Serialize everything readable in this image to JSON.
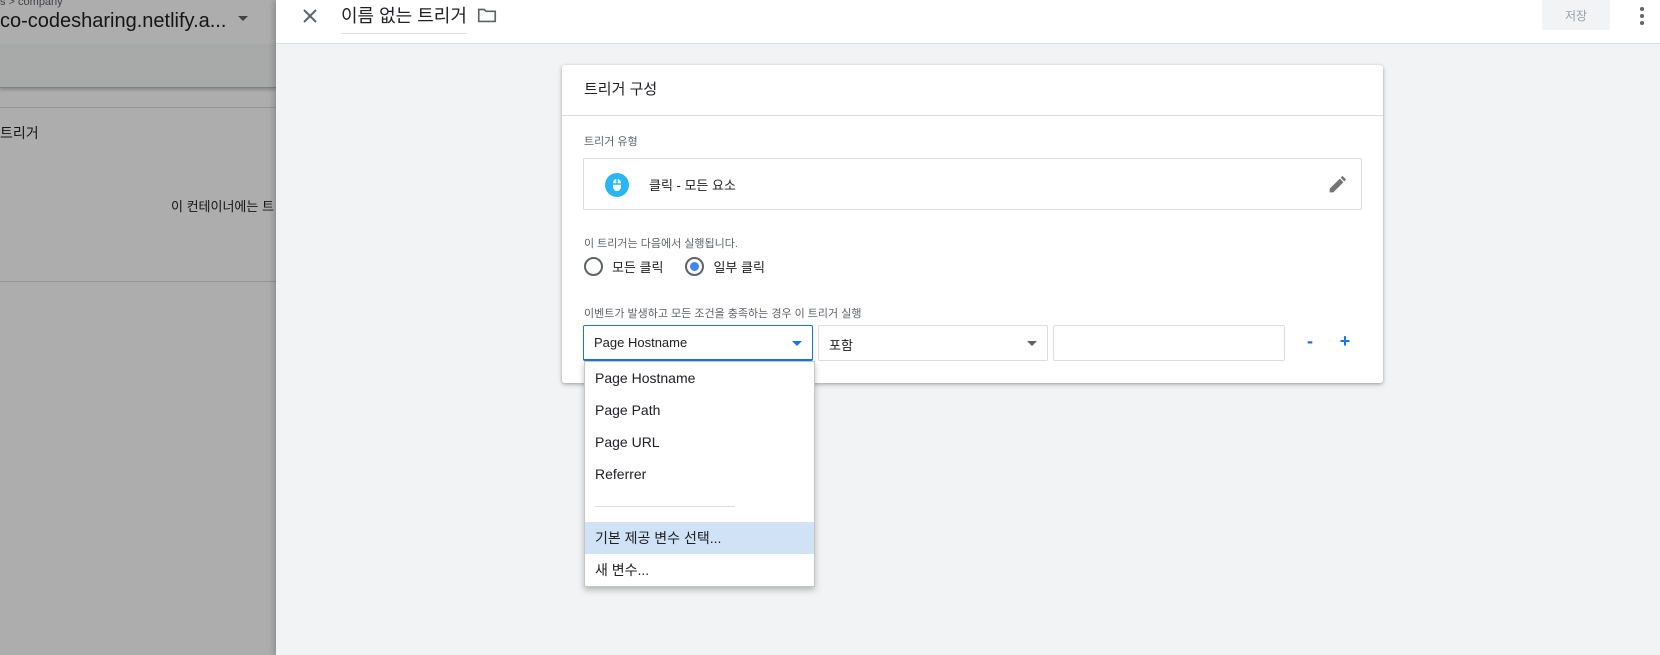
{
  "background": {
    "breadcrumb": "s > company",
    "container_name": "co-codesharing.netlify.a...",
    "card_title": "트리거",
    "card_empty_text": "이 컨테이너에는 트"
  },
  "header": {
    "trigger_name": "이름 없는 트리거",
    "save_label": "저장"
  },
  "card": {
    "title": "트리거 구성",
    "trigger_type_label": "트리거 유형",
    "trigger_type_value": "클릭 - 모든 요소",
    "fires_on_label": "이 트리거는 다음에서 실행됩니다.",
    "radio_all": "모든 클릭",
    "radio_some": "일부 클릭",
    "selected_radio": "일부 클릭",
    "condition_label": "이벤트가 발생하고 모든 조건을 충족하는 경우 이 트리거 실행",
    "variable_select": "Page Hostname",
    "operator_select": "포함",
    "value_input": "",
    "remove_label": "-",
    "add_label": "+"
  },
  "dropdown": {
    "items": [
      "Page Hostname",
      "Page Path",
      "Page URL",
      "Referrer"
    ],
    "builtin_item": "기본 제공 변수 선택...",
    "new_variable_item": "새 변수..."
  },
  "colors": {
    "accent": "#1a73e8",
    "radio_fill": "#4285f4",
    "mouse_icon": "#29b6f6",
    "highlight": "#cfe2f6"
  }
}
